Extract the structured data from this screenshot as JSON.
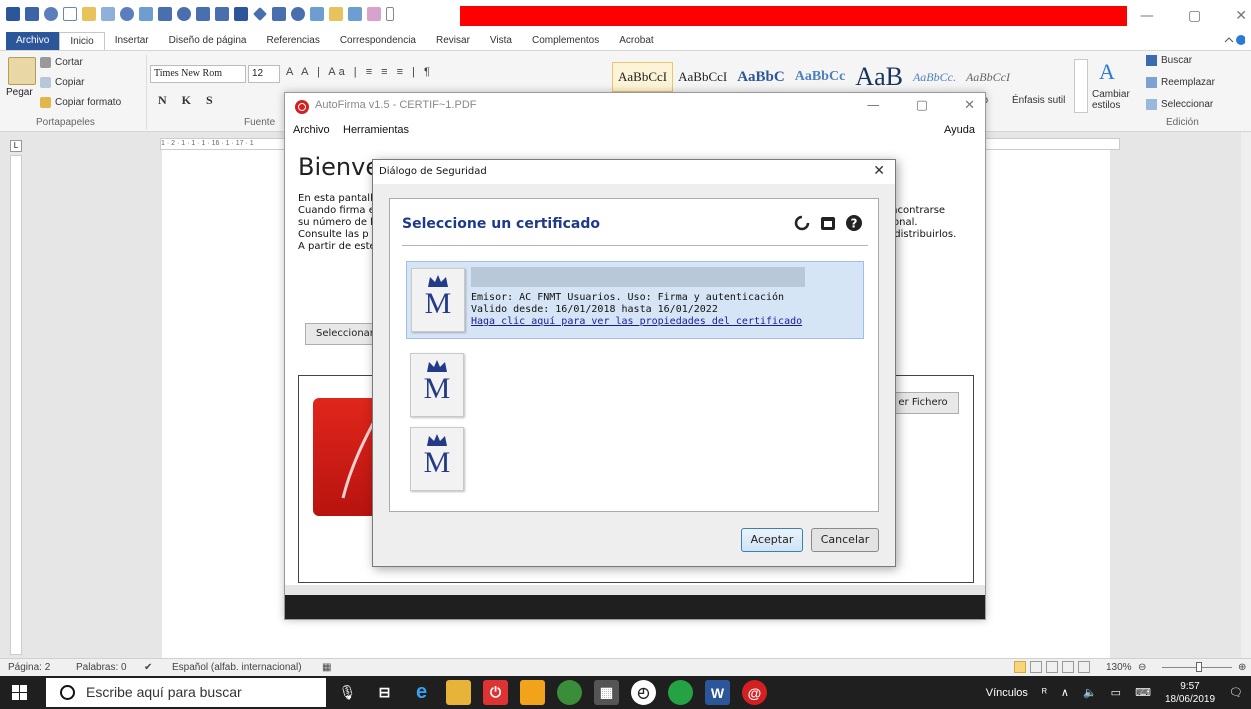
{
  "word": {
    "title_bar": {
      "min": "—",
      "max": "▢",
      "close": "✕"
    },
    "tabs": [
      "Archivo",
      "Inicio",
      "Insertar",
      "Diseño de página",
      "Referencias",
      "Correspondencia",
      "Revisar",
      "Vista",
      "Complementos",
      "Acrobat"
    ],
    "ribbon": {
      "clipboard": {
        "paste": "Pegar",
        "cut": "Cortar",
        "copy": "Copiar",
        "format_painter": "Copiar formato",
        "group": "Portapapeles"
      },
      "font": {
        "name": "Times New Rom",
        "size": "12",
        "group": "Fuente",
        "format_buttons": "N K S"
      },
      "styles": [
        {
          "label": "AaBbCcI",
          "selected": true
        },
        {
          "label": "AaBbCcI"
        },
        {
          "label": "AaBbC"
        },
        {
          "label": "AaBbCc"
        },
        {
          "label": "AaB"
        },
        {
          "label": "AaBbCc."
        },
        {
          "label": "AaBbCcI"
        }
      ],
      "style_names": {
        "hidden_left": "ilo",
        "subtle": "Énfasis sutil"
      },
      "change_styles": "Cambiar estilos",
      "editing": {
        "find": "Buscar",
        "replace": "Reemplazar",
        "select": "Seleccionar",
        "group": "Edición"
      }
    },
    "ruler_text": "1 · 2 · 1 · 1 · 1 · 16 · 1 · 17 · 1",
    "status": {
      "page": "Página: 2",
      "words": "Palabras: 0",
      "language": "Español (alfab. internacional)",
      "zoom": "130%"
    }
  },
  "autofirma": {
    "title": "AutoFirma v1.5 - CERTIF~1.PDF",
    "menu": {
      "file": "Archivo",
      "tools": "Herramientas",
      "help": "Ayuda"
    },
    "welcome": "Bienve",
    "paragraph": [
      "En esta pantall",
      "Cuando firma e",
      "su número de l",
      "Consulte las p",
      "A partir de este"
    ],
    "paragraph_right": [
      "encontrarse",
      "sional.",
      "o distribuirlos."
    ],
    "select_button": "Seleccionar",
    "view_file_button": "er Fichero"
  },
  "dialog": {
    "title": "Diálogo de Seguridad",
    "heading": "Seleccione un certificado",
    "certificates": [
      {
        "selected": true,
        "issuer_line": "Emisor: AC FNMT Usuarios. Uso: Firma y autenticación",
        "validity_line": "Valido desde: 16/01/2018 hasta 16/01/2022",
        "link": "Haga clic aquí para ver las propiedades del certificado"
      },
      {
        "selected": false
      },
      {
        "selected": false
      }
    ],
    "accept": "Aceptar",
    "cancel": "Cancelar"
  },
  "taskbar": {
    "search_placeholder": "Escribe aquí para buscar",
    "links_label": "Vínculos",
    "time": "9:57",
    "date": "18/06/2019"
  },
  "colors": {
    "word_blue": "#2b579a",
    "redaction_red": "#ff0000",
    "dialog_heading": "#1e3a8a",
    "selection": "#d6e5f6"
  }
}
